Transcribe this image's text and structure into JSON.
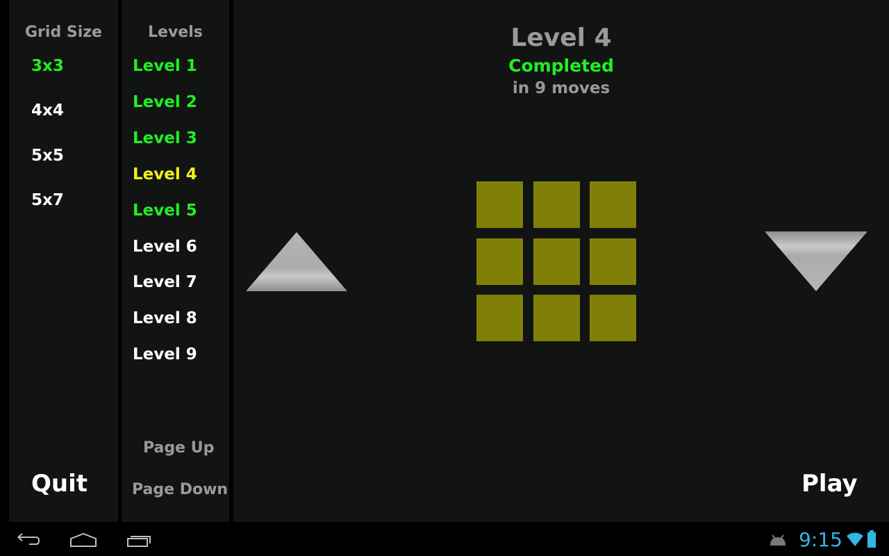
{
  "grid_size": {
    "header": "Grid Size",
    "items": [
      {
        "label": "3x3",
        "state": "selected"
      },
      {
        "label": "4x4",
        "state": "normal"
      },
      {
        "label": "5x5",
        "state": "normal"
      },
      {
        "label": "5x7",
        "state": "normal"
      }
    ],
    "quit_label": "Quit"
  },
  "levels": {
    "header": "Levels",
    "items": [
      {
        "label": "Level 1",
        "state": "completed"
      },
      {
        "label": "Level 2",
        "state": "completed"
      },
      {
        "label": "Level 3",
        "state": "completed"
      },
      {
        "label": "Level 4",
        "state": "current"
      },
      {
        "label": "Level 5",
        "state": "completed"
      },
      {
        "label": "Level 6",
        "state": "locked"
      },
      {
        "label": "Level 7",
        "state": "locked"
      },
      {
        "label": "Level 8",
        "state": "locked"
      },
      {
        "label": "Level 9",
        "state": "locked"
      }
    ],
    "page_up_label": "Page Up",
    "page_down_label": "Page Down"
  },
  "main": {
    "title": "Level 4",
    "status": "Completed",
    "moves": "in 9 moves",
    "board": {
      "rows": 3,
      "cols": 3,
      "tile_color": "#808008"
    },
    "play_label": "Play",
    "prev_arrow": "triangle-up-icon",
    "next_arrow": "triangle-down-icon"
  },
  "colors": {
    "completed": "#22ee22",
    "current": "#f2f21a",
    "normal": "#ffffff",
    "muted": "#9a9a9a",
    "clock": "#33b5e5"
  },
  "system_bar": {
    "clock": "9:15"
  }
}
